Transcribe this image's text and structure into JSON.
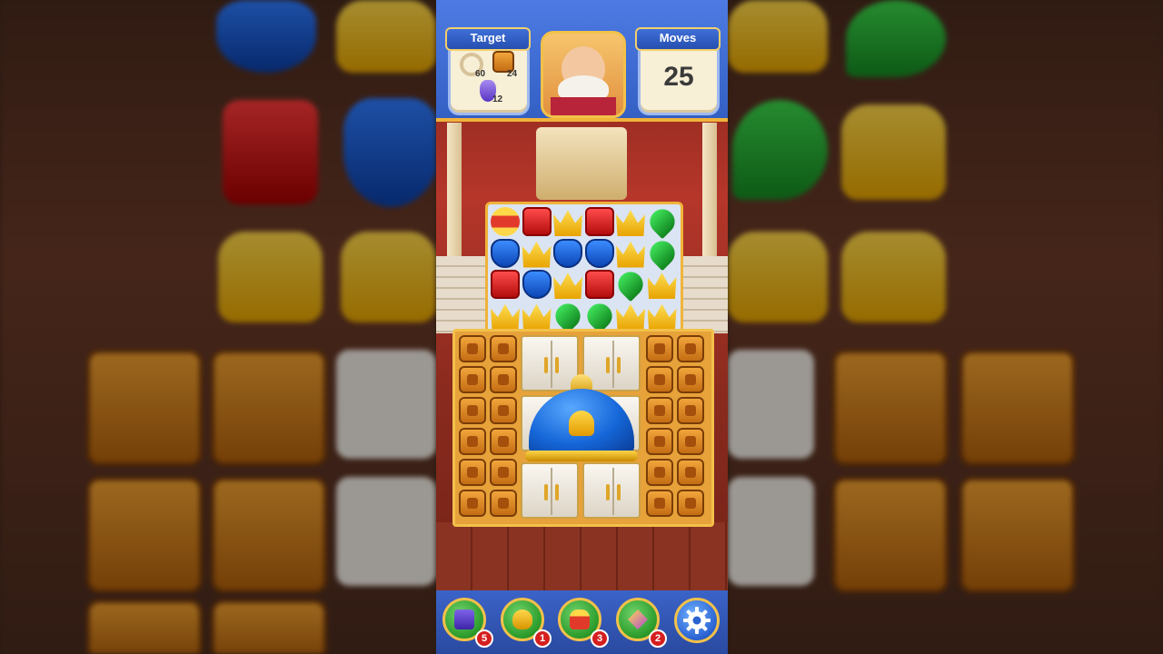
{
  "hud": {
    "target_label": "Target",
    "moves_label": "Moves",
    "moves_value": "25",
    "targets": [
      {
        "icon": "rope-ring-icon",
        "count": "60"
      },
      {
        "icon": "crate-icon",
        "count": "24"
      },
      {
        "icon": "vase-icon",
        "count": "12"
      }
    ]
  },
  "board": {
    "rows": [
      [
        "rocket",
        "red",
        "crown",
        "red",
        "crown",
        "leaf"
      ],
      [
        "shield",
        "crown",
        "shield",
        "shield",
        "crown",
        "leaf"
      ],
      [
        "red",
        "shield",
        "crown",
        "red",
        "leaf",
        "crown"
      ],
      [
        "crown",
        "crown",
        "leaf",
        "leaf",
        "crown",
        "crown"
      ]
    ]
  },
  "boosters": [
    {
      "name": "hammer-booster",
      "count": "5"
    },
    {
      "name": "glove-booster",
      "count": "1"
    },
    {
      "name": "lantern-booster",
      "count": "3"
    },
    {
      "name": "gem-booster",
      "count": "2"
    }
  ],
  "colors": {
    "hud_blue": "#3f6fd8",
    "gold": "#f0b33a",
    "badge_red": "#d51f1f"
  }
}
